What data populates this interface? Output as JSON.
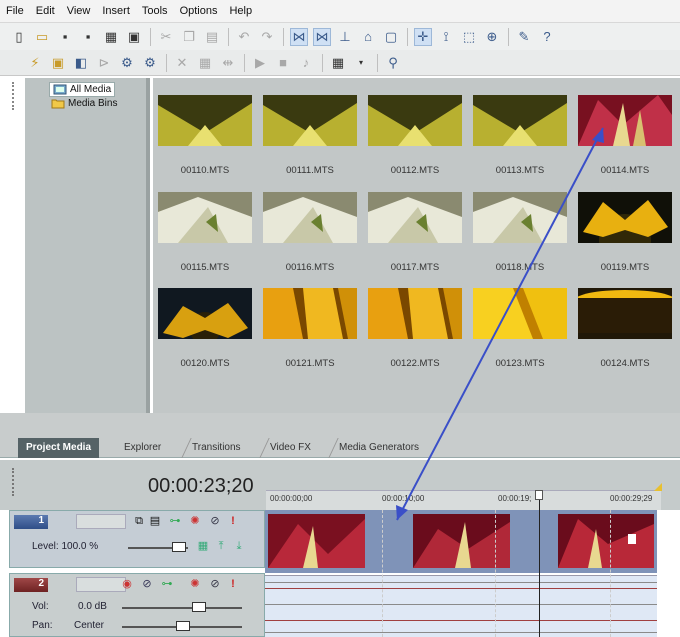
{
  "menu": [
    "File",
    "Edit",
    "View",
    "Insert",
    "Tools",
    "Options",
    "Help"
  ],
  "tree": {
    "all_media": "All Media",
    "media_bins": "Media Bins"
  },
  "media": [
    {
      "name": "00110.MTS",
      "kind": "yellow"
    },
    {
      "name": "00111.MTS",
      "kind": "yellow"
    },
    {
      "name": "00112.MTS",
      "kind": "yellow"
    },
    {
      "name": "00113.MTS",
      "kind": "yellow"
    },
    {
      "name": "00114.MTS",
      "kind": "red"
    },
    {
      "name": "00115.MTS",
      "kind": "white"
    },
    {
      "name": "00116.MTS",
      "kind": "white"
    },
    {
      "name": "00117.MTS",
      "kind": "white"
    },
    {
      "name": "00118.MTS",
      "kind": "white"
    },
    {
      "name": "00119.MTS",
      "kind": "sunflower"
    },
    {
      "name": "00120.MTS",
      "kind": "sunflower-dark"
    },
    {
      "name": "00121.MTS",
      "kind": "petals"
    },
    {
      "name": "00122.MTS",
      "kind": "petals"
    },
    {
      "name": "00123.MTS",
      "kind": "petals-bright"
    },
    {
      "name": "00124.MTS",
      "kind": "sunflower-half"
    }
  ],
  "tabs": [
    "Project Media",
    "Explorer",
    "Transitions",
    "Video FX",
    "Media Generators"
  ],
  "timeline": {
    "timecode": "00:00:23;20",
    "ruler": [
      "00:00:00;00",
      "00:00:10;00",
      "00:00:19;",
      "00:00:29;29"
    ]
  },
  "video_track": {
    "number": "1",
    "level_label": "Level: 100.0 %"
  },
  "audio_track": {
    "number": "2",
    "vol_label": "Vol:",
    "vol_value": "0.0 dB",
    "pan_label": "Pan:",
    "pan_value": "Center"
  },
  "colors": {
    "accent_blue": "#3a4fc8",
    "video_track": "#7f93b8",
    "audio_track_number": "#8a2a2a"
  }
}
